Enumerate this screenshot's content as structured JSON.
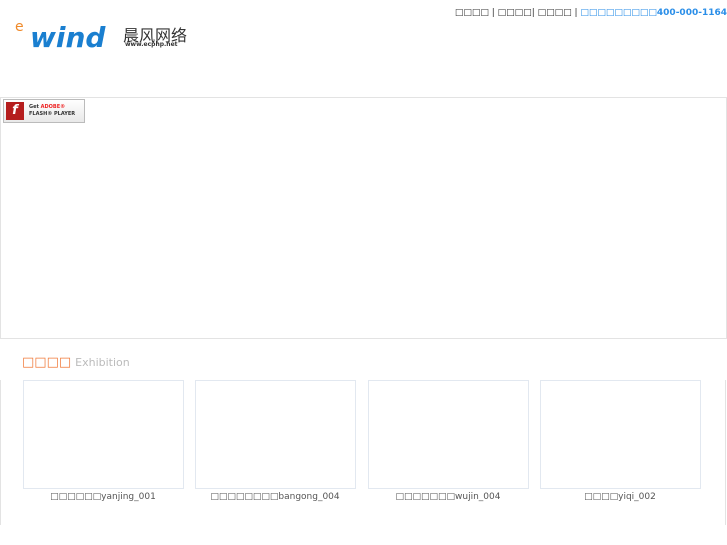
{
  "top_links": {
    "link1": "□□□□",
    "link2": "□□□□",
    "link3": "□□□□",
    "hotline_label": "□□□□□□□□□",
    "hotline_number": "400-000-1164"
  },
  "logo": {
    "brand": "ewind",
    "cn_name": "晨风网络",
    "url": "www.ecphp.net"
  },
  "flash_badge": {
    "get": "Get",
    "adobe": "ADOBE®",
    "player": "FLASH® PLAYER"
  },
  "exhibition": {
    "title": "□□□□",
    "subtitle": "Exhibition",
    "items": [
      {
        "caption": "□□□□□□yanjing_001"
      },
      {
        "caption": "□□□□□□□□bangong_004"
      },
      {
        "caption": "□□□□□□□wujin_004"
      },
      {
        "caption": "□□□□yiqi_002"
      }
    ]
  },
  "colors": {
    "accent": "#f07a3a",
    "link": "#2a8ee8"
  }
}
